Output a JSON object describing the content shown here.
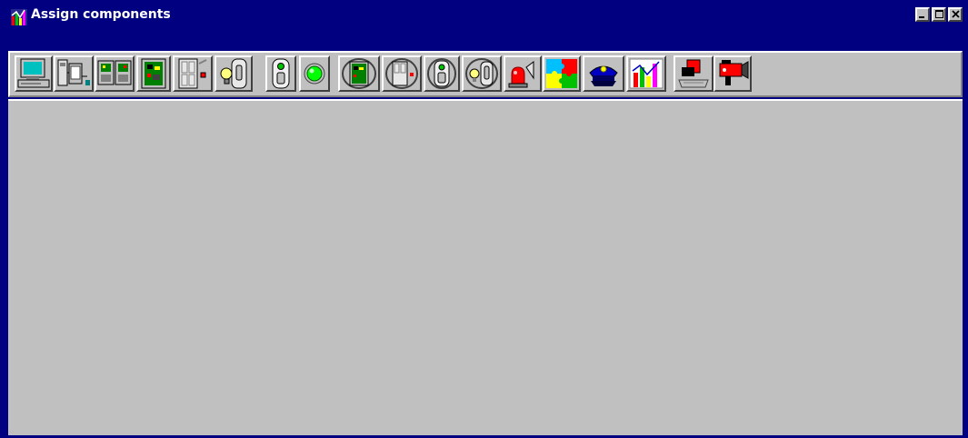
{
  "window": {
    "title": "Assign components",
    "controls": [
      "minimize",
      "maximize",
      "close"
    ]
  },
  "colors": {
    "titlebar": "#000080",
    "face": "#c0c0c0",
    "highlight": "#ffffff",
    "shadow": "#404040"
  },
  "toolbar": {
    "buttons": [
      {
        "icon": "computer-icon"
      },
      {
        "icon": "controller-unit-icon"
      },
      {
        "icon": "dual-module-icon"
      },
      {
        "icon": "circuit-board-icon"
      },
      {
        "icon": "door-icon"
      },
      {
        "icon": "light-switch-icon"
      },
      {
        "icon": "detector-icon"
      },
      {
        "icon": "green-light-icon"
      },
      {
        "icon": "board-group-icon"
      },
      {
        "icon": "door-group-icon"
      },
      {
        "icon": "detector-group-icon"
      },
      {
        "icon": "switch-group-icon"
      },
      {
        "icon": "alarm-siren-icon"
      },
      {
        "icon": "puzzle-zones-icon"
      },
      {
        "icon": "guard-cap-icon"
      },
      {
        "icon": "chart-graph-icon"
      },
      {
        "icon": "card-reader-icon"
      },
      {
        "icon": "video-camera-icon"
      }
    ]
  }
}
